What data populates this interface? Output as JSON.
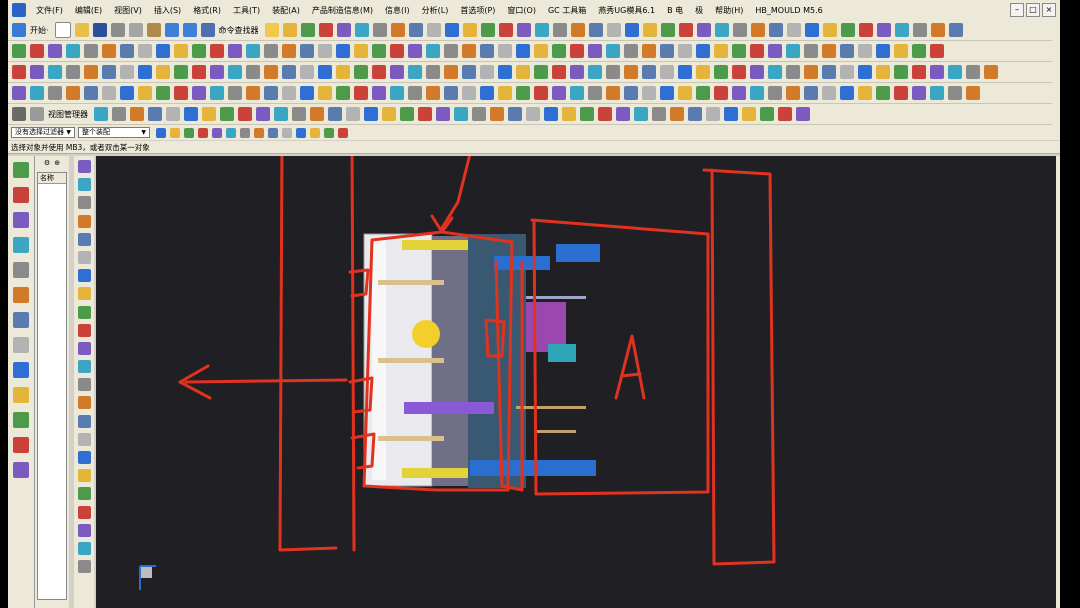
{
  "menu": {
    "items": [
      "文件(F)",
      "编辑(E)",
      "视图(V)",
      "插入(S)",
      "格式(R)",
      "工具(T)",
      "装配(A)",
      "产品制造信息(M)",
      "信息(I)",
      "分析(L)",
      "首选项(P)",
      "窗口(O)",
      "GC 工具箱",
      "燕秀UG模具6.1",
      "B 电",
      "极",
      "帮助(H)",
      "HB_MOULD M5.6"
    ]
  },
  "toolbar": {
    "start_label": "开始·",
    "command_finder_label": "命令查找器",
    "view_mgr_label": "视图管理器"
  },
  "selection": {
    "filter_value": "没有选择过滤器",
    "scope_value": "整个装配"
  },
  "cue_text": "选择对象并使用 MB3，或者双击某一对象",
  "navigator": {
    "column_header": "名称"
  },
  "annotation": {
    "letter": "A"
  },
  "colors": {
    "annotation_red": "#e0321e",
    "viewport_bg": "#1f1f24"
  }
}
